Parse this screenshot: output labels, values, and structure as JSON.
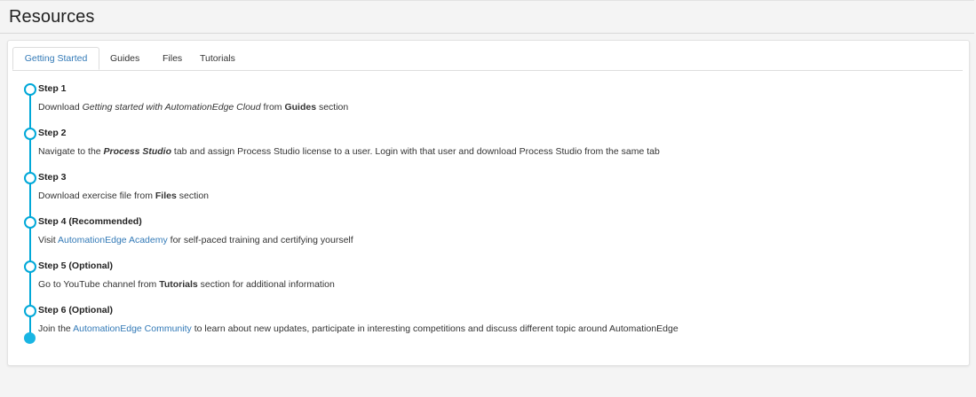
{
  "header": {
    "title": "Resources"
  },
  "tabs": [
    {
      "label": "Getting Started",
      "active": true
    },
    {
      "label": "Guides",
      "active": false
    },
    {
      "label": "Files",
      "active": false
    },
    {
      "label": "Tutorials",
      "active": false
    }
  ],
  "steps": [
    {
      "title": "Step 1",
      "desc": {
        "p1": "Download ",
        "em": "Getting started with AutomationEdge Cloud",
        "p2": " from ",
        "strong": "Guides",
        "p3": " section"
      }
    },
    {
      "title": "Step 2",
      "desc": {
        "p1": "Navigate to the ",
        "strong": "Process Studio",
        "p2": " tab and assign Process Studio license to a user. Login with that user and download Process Studio from the same tab"
      }
    },
    {
      "title": "Step 3",
      "desc": {
        "p1": "Download exercise file from ",
        "strong": "Files",
        "p2": " section"
      }
    },
    {
      "title": "Step 4 (Recommended)",
      "desc": {
        "p1": "Visit ",
        "link": "AutomationEdge Academy",
        "p2": " for self-paced training and certifying yourself"
      }
    },
    {
      "title": "Step 5 (Optional)",
      "desc": {
        "p1": "Go to YouTube channel from ",
        "strong": "Tutorials",
        "p2": " section for additional information"
      }
    },
    {
      "title": "Step 6 (Optional)",
      "desc": {
        "p1": "Join the ",
        "link": "AutomationEdge Community",
        "p2": " to learn about new updates, participate in interesting competitions and discuss different topic around AutomationEdge"
      }
    }
  ],
  "colors": {
    "accent": "#337ab7",
    "timeline": "#00a8d8"
  }
}
